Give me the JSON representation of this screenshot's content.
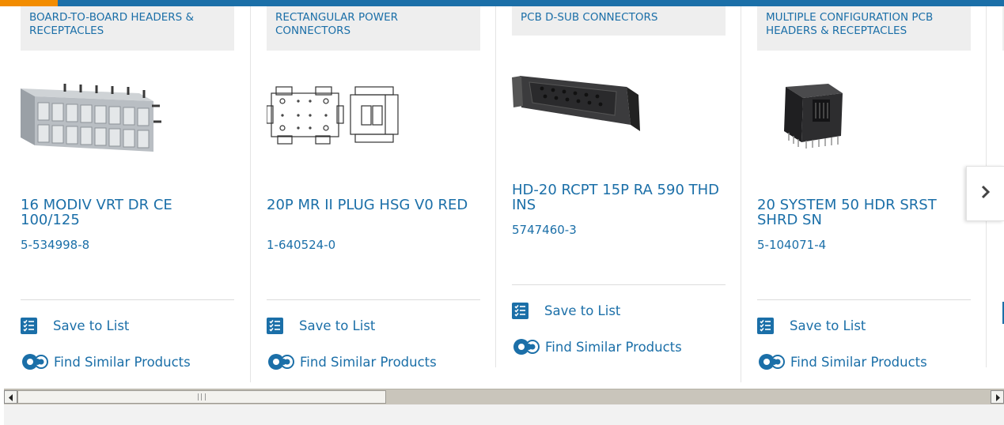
{
  "products": [
    {
      "category": "BOARD-TO-BOARD HEADERS & RECEPTACLES",
      "image_icon": "header-receptacle-image",
      "title": "16 MODIV VRT DR CE 100/125",
      "part_number": "5-534998-8",
      "save_label": "Save to List",
      "similar_label": "Find Similar Products"
    },
    {
      "category": "RECTANGULAR POWER CONNECTORS",
      "image_icon": "power-connector-drawing-image",
      "title": "20P MR II PLUG HSG V0 RED",
      "part_number": "1-640524-0",
      "save_label": "Save to List",
      "similar_label": "Find Similar Products"
    },
    {
      "category": "PCB D-SUB CONNECTORS",
      "image_icon": "dsub-connector-image",
      "title": "HD-20 RCPT 15P RA 590 THD INS",
      "part_number": "5747460-3",
      "save_label": "Save to List",
      "similar_label": "Find Similar Products"
    },
    {
      "category": "MULTIPLE CONFIGURATION PCB HEADERS & RECEPTACLES",
      "image_icon": "shrouded-header-image",
      "title": "20 SYSTEM 50 HDR SRST SHRD SN",
      "part_number": "5-104071-4",
      "save_label": "Save to List",
      "similar_label": "Find Similar Products"
    }
  ],
  "carousel": {
    "next_icon": "chevron-right-icon"
  },
  "scrollbar": {
    "left_icon": "arrow-left-icon",
    "right_icon": "arrow-right-icon",
    "position_fraction": 0.0
  },
  "colors": {
    "brand_blue": "#1b6fa8",
    "accent_orange": "#f28c00",
    "category_bg": "#eeeeee"
  }
}
